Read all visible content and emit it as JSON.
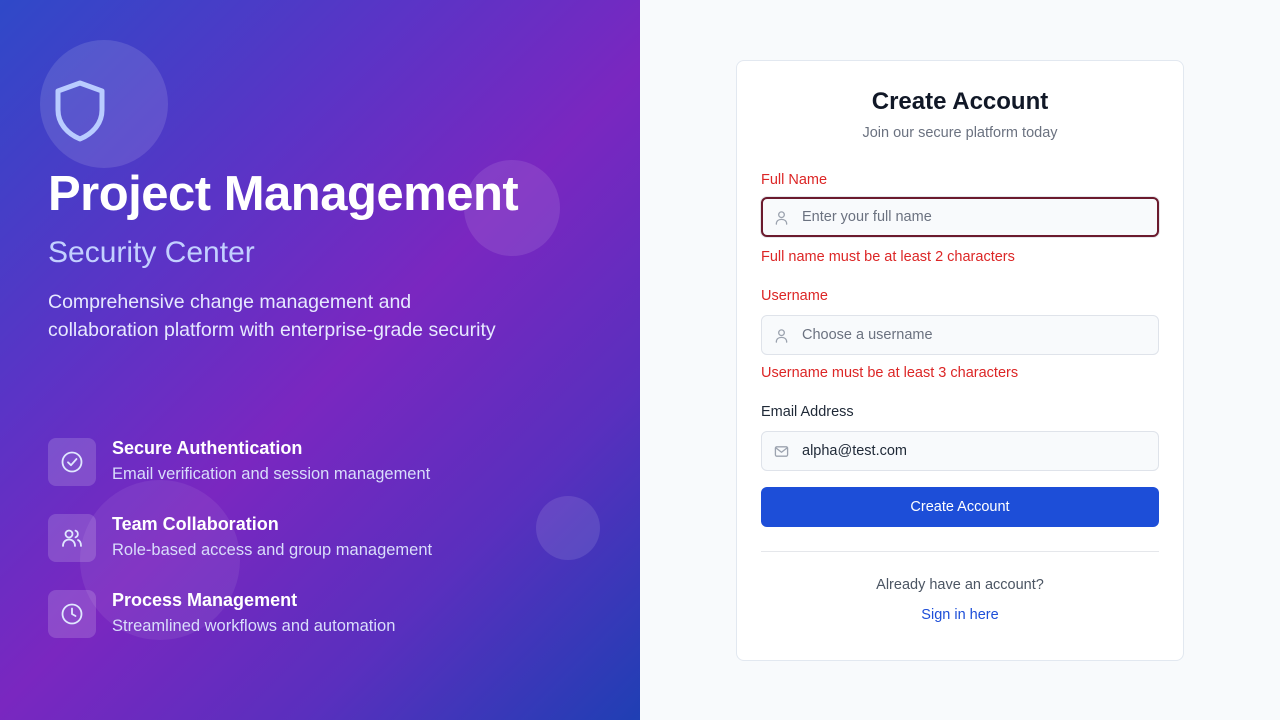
{
  "hero": {
    "title": "Project Management",
    "subtitle": "Security Center",
    "description": "Comprehensive change management and collaboration platform with enterprise-grade security",
    "logo_icon": "shield-icon",
    "features": [
      {
        "icon": "check-circle-icon",
        "title": "Secure Authentication",
        "description": "Email verification and session management"
      },
      {
        "icon": "users-icon",
        "title": "Team Collaboration",
        "description": "Role-based access and group management"
      },
      {
        "icon": "clock-icon",
        "title": "Process Management",
        "description": "Streamlined workflows and automation"
      }
    ]
  },
  "form": {
    "title": "Create Account",
    "subtitle": "Join our secure platform today",
    "fields": {
      "full_name": {
        "label": "Full Name",
        "placeholder": "Enter your full name",
        "value": "",
        "icon": "user-icon",
        "error": "Full name must be at least 2 characters"
      },
      "username": {
        "label": "Username",
        "placeholder": "Choose a username",
        "value": "",
        "icon": "user-icon",
        "error": "Username must be at least 3 characters"
      },
      "email": {
        "label": "Email Address",
        "placeholder": "",
        "value": "alpha@test.com",
        "icon": "mail-icon"
      }
    },
    "submit_label": "Create Account",
    "already_text": "Already have an account?",
    "signin_link": "Sign in here"
  },
  "colors": {
    "primary": "#1d4ed8",
    "error": "#dc2626",
    "hero_gradient_start": "#2f49c8",
    "hero_gradient_mid": "#7a27c0",
    "hero_gradient_end": "#1f3fb4"
  }
}
